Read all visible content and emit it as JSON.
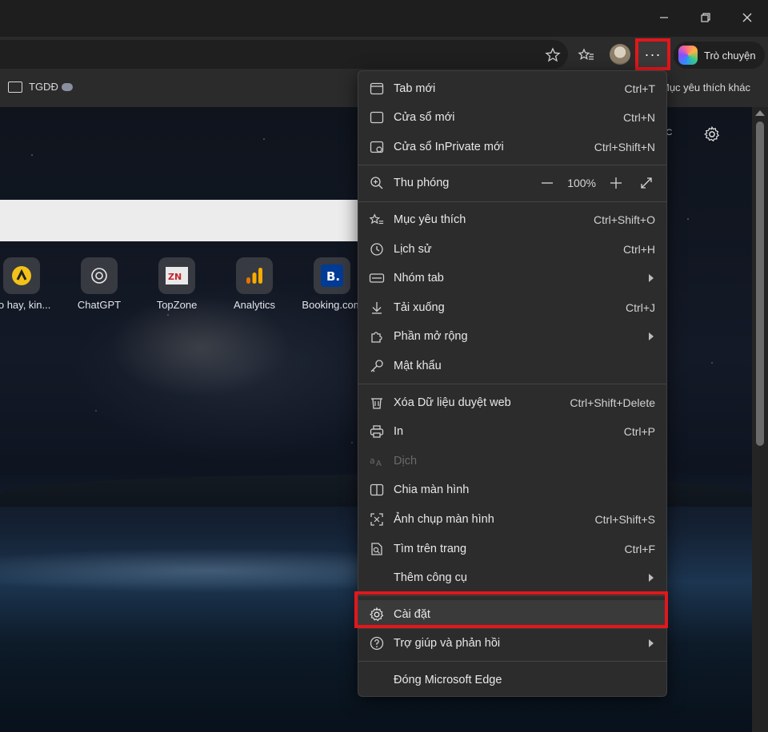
{
  "window": {
    "controls": [
      "minimize",
      "restore",
      "close"
    ]
  },
  "toolbar": {
    "more_label": "···",
    "chat_label": "Trò chuyện"
  },
  "favorites": {
    "folder": "TGDĐ",
    "other": "Mục yêu thích khác"
  },
  "newtab": {
    "temp_unit": "°C",
    "tiles": [
      {
        "label": "eo hay, kin..."
      },
      {
        "label": "ChatGPT"
      },
      {
        "label": "TopZone"
      },
      {
        "label": "Analytics"
      },
      {
        "label": "Booking.com"
      }
    ]
  },
  "menu": {
    "items": [
      {
        "label": "Tab mới",
        "shortcut": "Ctrl+T",
        "icon": "new-tab-icon"
      },
      {
        "label": "Cửa sổ mới",
        "shortcut": "Ctrl+N",
        "icon": "new-window-icon"
      },
      {
        "label": "Cửa sổ InPrivate mới",
        "shortcut": "Ctrl+Shift+N",
        "icon": "inprivate-icon"
      },
      {
        "label": "Thu phóng",
        "zoom": "100%",
        "icon": "zoom-icon"
      },
      {
        "label": "Mục yêu thích",
        "shortcut": "Ctrl+Shift+O",
        "icon": "favorites-icon"
      },
      {
        "label": "Lịch sử",
        "shortcut": "Ctrl+H",
        "icon": "history-icon"
      },
      {
        "label": "Nhóm tab",
        "icon": "tab-groups-icon"
      },
      {
        "label": "Tải xuống",
        "shortcut": "Ctrl+J",
        "icon": "download-icon"
      },
      {
        "label": "Phần mở rộng",
        "icon": "extensions-icon"
      },
      {
        "label": "Mật khẩu",
        "icon": "key-icon"
      },
      {
        "label": "Xóa Dữ liệu duyệt web",
        "shortcut": "Ctrl+Shift+Delete",
        "icon": "trash-icon"
      },
      {
        "label": "In",
        "shortcut": "Ctrl+P",
        "icon": "print-icon"
      },
      {
        "label": "Dịch",
        "icon": "translate-icon"
      },
      {
        "label": "Chia màn hình",
        "icon": "split-screen-icon"
      },
      {
        "label": "Ảnh chụp màn hình",
        "shortcut": "Ctrl+Shift+S",
        "icon": "screenshot-icon"
      },
      {
        "label": "Tìm trên trang",
        "shortcut": "Ctrl+F",
        "icon": "find-icon"
      },
      {
        "label": "Thêm công cụ",
        "icon": "more-tools-icon"
      },
      {
        "label": "Cài đặt",
        "icon": "settings-icon"
      },
      {
        "label": "Trợ giúp và phản hồi",
        "icon": "help-icon"
      },
      {
        "label": "Đóng Microsoft Edge",
        "icon": "close-edge-icon"
      }
    ]
  },
  "colors": {
    "highlight_border": "#e2171b",
    "menu_bg": "#2c2c2c"
  }
}
